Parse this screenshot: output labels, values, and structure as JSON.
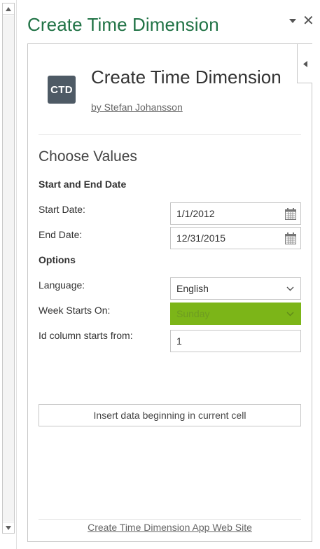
{
  "task_pane": {
    "title": "Create Time Dimension",
    "close_glyph": "✕"
  },
  "app": {
    "logo_text": "CTD",
    "title": "Create Time Dimension",
    "author": "by Stefan Johansson"
  },
  "form": {
    "section_title": "Choose Values",
    "dates_heading": "Start and End Date",
    "start_date_label": "Start Date:",
    "start_date_value": "1/1/2012",
    "end_date_label": "End Date:",
    "end_date_value": "12/31/2015",
    "options_heading": "Options",
    "language_label": "Language:",
    "language_value": "English",
    "week_start_label": "Week Starts On:",
    "week_start_value": "Sunday",
    "id_start_label": "Id column starts from:",
    "id_start_value": "1"
  },
  "insert_button_label": "Insert data beginning in current cell",
  "footer_link": "Create Time Dimension App Web Site",
  "colors": {
    "accent_green": "#217346",
    "selected_dropdown": "#7cb518",
    "logo_bg": "#4e5a65"
  }
}
